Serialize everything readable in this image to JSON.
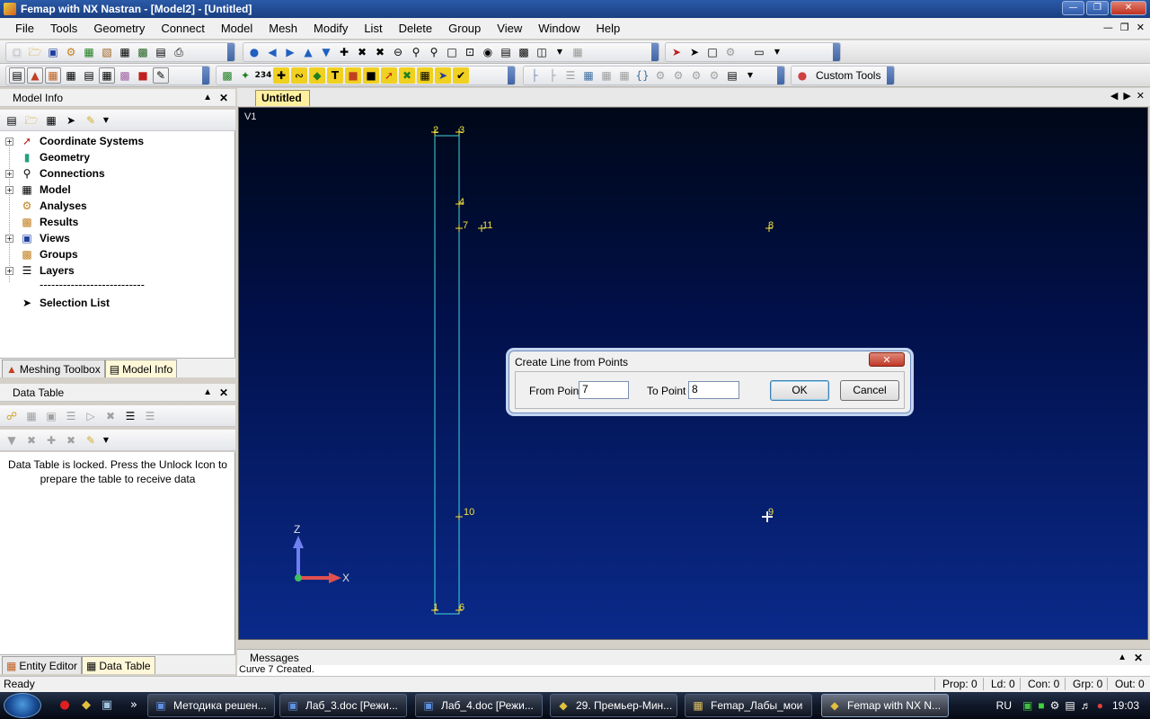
{
  "window": {
    "title": "Femap with NX Nastran - [Model2] - [Untitled]",
    "minimize": "0",
    "restore": "1",
    "close": "r"
  },
  "menu": [
    "File",
    "Tools",
    "Geometry",
    "Connect",
    "Model",
    "Mesh",
    "Modify",
    "List",
    "Delete",
    "Group",
    "View",
    "Window",
    "Help"
  ],
  "custom_tools": {
    "label": "Custom Tools"
  },
  "model_info": {
    "title": "Model Info",
    "tree": [
      {
        "label": "Coordinate Systems",
        "icon": "coordinate-systems-icon"
      },
      {
        "label": "Geometry",
        "icon": "geometry-icon"
      },
      {
        "label": "Connections",
        "icon": "connections-icon"
      },
      {
        "label": "Model",
        "icon": "model-icon"
      },
      {
        "label": "Analyses",
        "icon": "analyses-icon"
      },
      {
        "label": "Results",
        "icon": "results-icon"
      },
      {
        "label": "Views",
        "icon": "views-icon"
      },
      {
        "label": "Groups",
        "icon": "groups-icon"
      },
      {
        "label": "Layers",
        "icon": "layers-icon"
      }
    ],
    "separator": "---------------------------",
    "selection_list": "Selection List",
    "tabs": [
      "Meshing Toolbox",
      "Model Info"
    ]
  },
  "data_table": {
    "title": "Data Table",
    "locked_message": "Data Table is locked. Press the Unlock Icon to prepare the table to receive data",
    "tabs": [
      "Entity Editor",
      "Data Table"
    ]
  },
  "doc_tab": "Untitled",
  "viewport": {
    "view_label": "V1",
    "points": [
      "2",
      "3",
      "4",
      "7",
      "11",
      "8",
      "10",
      "9",
      "1",
      "6"
    ],
    "axis_z": "Z",
    "axis_x": "X"
  },
  "dialog": {
    "title": "Create Line from Points",
    "from_label": "From Point",
    "from_value": "7",
    "to_label": "To Point",
    "to_value": "8",
    "ok": "OK",
    "cancel": "Cancel"
  },
  "messages": {
    "title": "Messages",
    "last_line": "Curve 7 Created."
  },
  "status": {
    "ready": "Ready",
    "prop": "Prop: 0",
    "ld": "Ld: 0",
    "con": "Con: 0",
    "grp": "Grp: 0",
    "out": "Out: 0"
  },
  "taskbar": {
    "buttons": [
      "Методика решен...",
      "Лаб_3.doc [Режи...",
      "Лаб_4.doc [Режи...",
      "29. Премьер-Мин...",
      "Femap_Лабы_мои",
      "Femap with NX N..."
    ],
    "quicklaunch_more": "»",
    "lang": "RU",
    "time": "19:03"
  }
}
